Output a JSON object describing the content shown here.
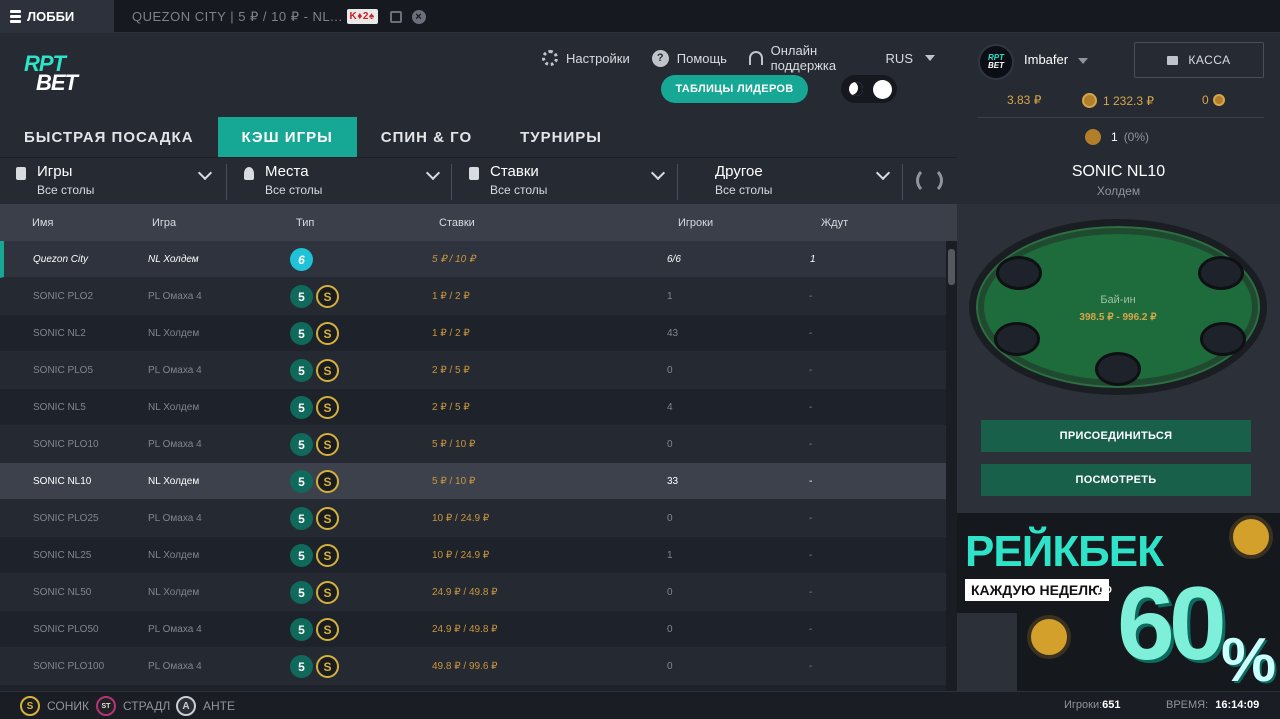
{
  "tabs": {
    "lobby": "ЛОББИ",
    "table_tab": "QUEZON CITY  |  5 ₽ / 10 ₽ - NL...",
    "mini_cards": "K♦2♠"
  },
  "logo": {
    "line1": "RPT",
    "line2": "BET"
  },
  "header": {
    "settings": "Настройки",
    "help": "Помощь",
    "support": "Онлайн поддержка",
    "language": "RUS",
    "leaders_button": "ТАБЛИЦЫ ЛИДЕРОВ"
  },
  "account": {
    "username": "Imbafer",
    "cashier": "КАССА",
    "balance": "3.83 ₽",
    "points": "1 232.3 ₽",
    "tickets": "0",
    "rank": "1",
    "rank_pct": "(0%)"
  },
  "categories": [
    "БЫСТРАЯ ПОСАДКА",
    "КЭШ ИГРЫ",
    "СПИН & ГО",
    "ТУРНИРЫ"
  ],
  "active_category": "КЭШ ИГРЫ",
  "filters": [
    {
      "title": "Игры",
      "value": "Все столы"
    },
    {
      "title": "Места",
      "value": "Все столы"
    },
    {
      "title": "Ставки",
      "value": "Все столы"
    },
    {
      "title": "Другое",
      "value": "Все столы"
    }
  ],
  "columns": {
    "name": "Имя",
    "game": "Игра",
    "type": "Тип",
    "stakes": "Ставки",
    "players": "Игроки",
    "waiting": "Ждут"
  },
  "rows": [
    {
      "name": "Quezon City",
      "game": "NL Холдем",
      "seats": "6",
      "sonic": false,
      "stakes": "5 ₽ / 10 ₽",
      "players": "6/6",
      "waiting": "1"
    },
    {
      "name": "SONIC PLO2",
      "game": "PL Омаха 4",
      "seats": "5",
      "sonic": true,
      "stakes": "1 ₽ / 2 ₽",
      "players": "1",
      "waiting": "-"
    },
    {
      "name": "SONIC NL2",
      "game": "NL Холдем",
      "seats": "5",
      "sonic": true,
      "stakes": "1 ₽ / 2 ₽",
      "players": "43",
      "waiting": "-"
    },
    {
      "name": "SONIC PLO5",
      "game": "PL Омаха 4",
      "seats": "5",
      "sonic": true,
      "stakes": "2 ₽ / 5 ₽",
      "players": "0",
      "waiting": "-"
    },
    {
      "name": "SONIC NL5",
      "game": "NL Холдем",
      "seats": "5",
      "sonic": true,
      "stakes": "2 ₽ / 5 ₽",
      "players": "4",
      "waiting": "-"
    },
    {
      "name": "SONIC PLO10",
      "game": "PL Омаха 4",
      "seats": "5",
      "sonic": true,
      "stakes": "5 ₽ / 10 ₽",
      "players": "0",
      "waiting": "-"
    },
    {
      "name": "SONIC NL10",
      "game": "NL Холдем",
      "seats": "5",
      "sonic": true,
      "stakes": "5 ₽ / 10 ₽",
      "players": "33",
      "waiting": "-"
    },
    {
      "name": "SONIC PLO25",
      "game": "PL Омаха 4",
      "seats": "5",
      "sonic": true,
      "stakes": "10 ₽ / 24.9 ₽",
      "players": "0",
      "waiting": "-"
    },
    {
      "name": "SONIC NL25",
      "game": "NL Холдем",
      "seats": "5",
      "sonic": true,
      "stakes": "10 ₽ / 24.9 ₽",
      "players": "1",
      "waiting": "-"
    },
    {
      "name": "SONIC NL50",
      "game": "NL Холдем",
      "seats": "5",
      "sonic": true,
      "stakes": "24.9 ₽ / 49.8 ₽",
      "players": "0",
      "waiting": "-"
    },
    {
      "name": "SONIC PLO50",
      "game": "PL Омаха 4",
      "seats": "5",
      "sonic": true,
      "stakes": "24.9 ₽ / 49.8 ₽",
      "players": "0",
      "waiting": "-"
    },
    {
      "name": "SONIC PLO100",
      "game": "PL Омаха 4",
      "seats": "5",
      "sonic": true,
      "stakes": "49.8 ₽ / 99.6 ₽",
      "players": "0",
      "waiting": "-"
    }
  ],
  "selected_row": "SONIC NL10",
  "preview": {
    "title": "SONIC NL10",
    "subtitle": "Холдем",
    "buyin_label": "Бай-ин",
    "buyin_value": "398.5 ₽ - 996.2 ₽",
    "join_button": "ПРИСОЕДИНИТЬСЯ",
    "watch_button": "ПОСМОТРЕТЬ"
  },
  "promo": {
    "title": "РЕЙКБЕК",
    "subtitle": "КАЖДУЮ НЕДЕЛЮ",
    "upto": "ДО",
    "value": "60",
    "pct": "%"
  },
  "footer": {
    "legend": [
      {
        "badge": "S",
        "label": "СОНИК"
      },
      {
        "badge": "ST",
        "label": "СТРАДЛ"
      },
      {
        "badge": "A",
        "label": "АНТЕ"
      }
    ],
    "players_label": "Игроки:",
    "players_value": "651",
    "time_label": "ВРЕМЯ:",
    "time_value": "16:14:09"
  },
  "colors": {
    "accent": "#16a795",
    "stake": "#c9963e",
    "felt": "#1e6b3c",
    "sonic": "#d4b13c"
  }
}
